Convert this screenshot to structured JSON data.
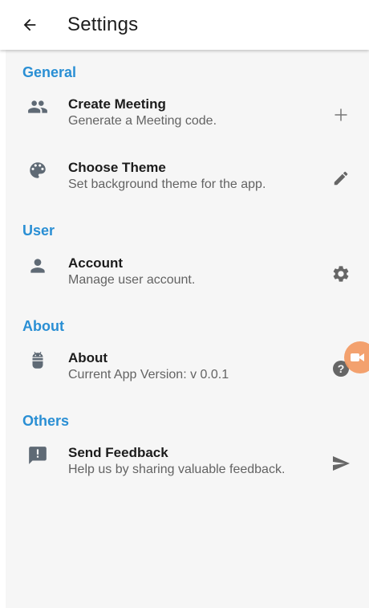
{
  "appbar": {
    "title": "Settings",
    "back_icon": "arrow-back-icon"
  },
  "colors": {
    "accent": "#2a8fd4",
    "icon": "#5f6a75",
    "background": "#f6f6f6",
    "fab": "#f39a63"
  },
  "sections": {
    "general": {
      "header": "General",
      "create_meeting": {
        "title": "Create Meeting",
        "subtitle": "Generate a Meeting code.",
        "icon": "group-icon",
        "action_icon": "plus-icon"
      },
      "choose_theme": {
        "title": "Choose Theme",
        "subtitle": "Set background theme for the app.",
        "icon": "palette-icon",
        "action_icon": "pencil-icon"
      }
    },
    "user": {
      "header": "User",
      "account": {
        "title": "Account",
        "subtitle": "Manage user account.",
        "icon": "person-icon",
        "action_icon": "gear-icon"
      }
    },
    "about": {
      "header": "About",
      "about": {
        "title": "About",
        "subtitle": "Current App Version:   v 0.0.1",
        "icon": "android-icon",
        "action_icon": "help-icon"
      }
    },
    "others": {
      "header": "Others",
      "send_feedback": {
        "title": "Send Feedback",
        "subtitle": "Help us by sharing valuable feedback.",
        "icon": "feedback-icon",
        "action_icon": "send-icon"
      }
    }
  }
}
